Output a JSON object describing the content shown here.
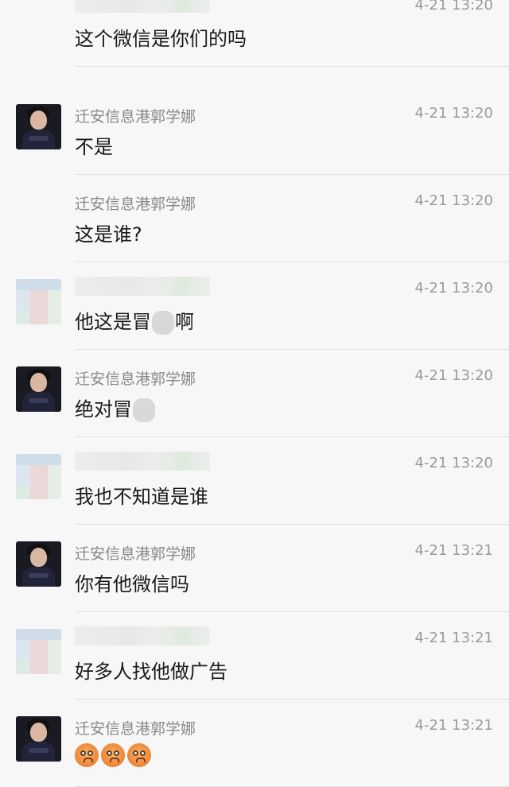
{
  "chat": {
    "messages": [
      {
        "sender": "",
        "sender_censored": true,
        "avatar": "none",
        "time": "4-21 13:20",
        "text": "这个微信是你们的吗"
      },
      {
        "sender": "迁安信息港郭学娜",
        "sender_censored": false,
        "avatar": "photo",
        "time": "4-21 13:20",
        "text": "不是"
      },
      {
        "sender": "迁安信息港郭学娜",
        "sender_censored": false,
        "avatar": "none",
        "time": "4-21 13:20",
        "text": "这是谁?"
      },
      {
        "sender": "",
        "sender_censored": true,
        "avatar": "blurred",
        "time": "4-21 13:20",
        "text_before": "他这是冒",
        "text_after": "啊"
      },
      {
        "sender": "迁安信息港郭学娜",
        "sender_censored": false,
        "avatar": "photo",
        "time": "4-21 13:20",
        "text_before": "绝对冒",
        "text_after": ""
      },
      {
        "sender": "",
        "sender_censored": true,
        "avatar": "blurred",
        "time": "4-21 13:20",
        "text": "我也不知道是谁"
      },
      {
        "sender": "迁安信息港郭学娜",
        "sender_censored": false,
        "avatar": "photo",
        "time": "4-21 13:21",
        "text": "你有他微信吗"
      },
      {
        "sender": "",
        "sender_censored": true,
        "avatar": "blurred",
        "time": "4-21 13:21",
        "text": "好多人找他做广告"
      },
      {
        "sender": "迁安信息港郭学娜",
        "sender_censored": false,
        "avatar": "photo",
        "time": "4-21 13:21",
        "emoji": [
          "frown-emoji",
          "frown-emoji",
          "frown-emoji"
        ]
      }
    ]
  }
}
